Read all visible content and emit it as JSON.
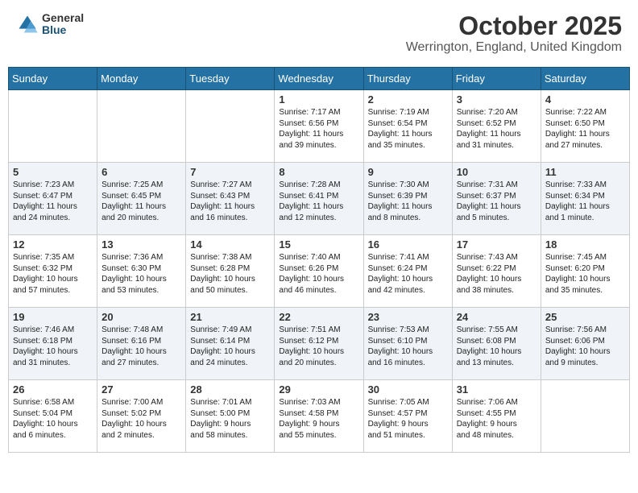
{
  "header": {
    "logo_general": "General",
    "logo_blue": "Blue",
    "month_title": "October 2025",
    "location": "Werrington, England, United Kingdom"
  },
  "days_of_week": [
    "Sunday",
    "Monday",
    "Tuesday",
    "Wednesday",
    "Thursday",
    "Friday",
    "Saturday"
  ],
  "weeks": [
    {
      "shaded": false,
      "days": [
        {
          "num": "",
          "info": ""
        },
        {
          "num": "",
          "info": ""
        },
        {
          "num": "",
          "info": ""
        },
        {
          "num": "1",
          "info": "Sunrise: 7:17 AM\nSunset: 6:56 PM\nDaylight: 11 hours\nand 39 minutes."
        },
        {
          "num": "2",
          "info": "Sunrise: 7:19 AM\nSunset: 6:54 PM\nDaylight: 11 hours\nand 35 minutes."
        },
        {
          "num": "3",
          "info": "Sunrise: 7:20 AM\nSunset: 6:52 PM\nDaylight: 11 hours\nand 31 minutes."
        },
        {
          "num": "4",
          "info": "Sunrise: 7:22 AM\nSunset: 6:50 PM\nDaylight: 11 hours\nand 27 minutes."
        }
      ]
    },
    {
      "shaded": true,
      "days": [
        {
          "num": "5",
          "info": "Sunrise: 7:23 AM\nSunset: 6:47 PM\nDaylight: 11 hours\nand 24 minutes."
        },
        {
          "num": "6",
          "info": "Sunrise: 7:25 AM\nSunset: 6:45 PM\nDaylight: 11 hours\nand 20 minutes."
        },
        {
          "num": "7",
          "info": "Sunrise: 7:27 AM\nSunset: 6:43 PM\nDaylight: 11 hours\nand 16 minutes."
        },
        {
          "num": "8",
          "info": "Sunrise: 7:28 AM\nSunset: 6:41 PM\nDaylight: 11 hours\nand 12 minutes."
        },
        {
          "num": "9",
          "info": "Sunrise: 7:30 AM\nSunset: 6:39 PM\nDaylight: 11 hours\nand 8 minutes."
        },
        {
          "num": "10",
          "info": "Sunrise: 7:31 AM\nSunset: 6:37 PM\nDaylight: 11 hours\nand 5 minutes."
        },
        {
          "num": "11",
          "info": "Sunrise: 7:33 AM\nSunset: 6:34 PM\nDaylight: 11 hours\nand 1 minute."
        }
      ]
    },
    {
      "shaded": false,
      "days": [
        {
          "num": "12",
          "info": "Sunrise: 7:35 AM\nSunset: 6:32 PM\nDaylight: 10 hours\nand 57 minutes."
        },
        {
          "num": "13",
          "info": "Sunrise: 7:36 AM\nSunset: 6:30 PM\nDaylight: 10 hours\nand 53 minutes."
        },
        {
          "num": "14",
          "info": "Sunrise: 7:38 AM\nSunset: 6:28 PM\nDaylight: 10 hours\nand 50 minutes."
        },
        {
          "num": "15",
          "info": "Sunrise: 7:40 AM\nSunset: 6:26 PM\nDaylight: 10 hours\nand 46 minutes."
        },
        {
          "num": "16",
          "info": "Sunrise: 7:41 AM\nSunset: 6:24 PM\nDaylight: 10 hours\nand 42 minutes."
        },
        {
          "num": "17",
          "info": "Sunrise: 7:43 AM\nSunset: 6:22 PM\nDaylight: 10 hours\nand 38 minutes."
        },
        {
          "num": "18",
          "info": "Sunrise: 7:45 AM\nSunset: 6:20 PM\nDaylight: 10 hours\nand 35 minutes."
        }
      ]
    },
    {
      "shaded": true,
      "days": [
        {
          "num": "19",
          "info": "Sunrise: 7:46 AM\nSunset: 6:18 PM\nDaylight: 10 hours\nand 31 minutes."
        },
        {
          "num": "20",
          "info": "Sunrise: 7:48 AM\nSunset: 6:16 PM\nDaylight: 10 hours\nand 27 minutes."
        },
        {
          "num": "21",
          "info": "Sunrise: 7:49 AM\nSunset: 6:14 PM\nDaylight: 10 hours\nand 24 minutes."
        },
        {
          "num": "22",
          "info": "Sunrise: 7:51 AM\nSunset: 6:12 PM\nDaylight: 10 hours\nand 20 minutes."
        },
        {
          "num": "23",
          "info": "Sunrise: 7:53 AM\nSunset: 6:10 PM\nDaylight: 10 hours\nand 16 minutes."
        },
        {
          "num": "24",
          "info": "Sunrise: 7:55 AM\nSunset: 6:08 PM\nDaylight: 10 hours\nand 13 minutes."
        },
        {
          "num": "25",
          "info": "Sunrise: 7:56 AM\nSunset: 6:06 PM\nDaylight: 10 hours\nand 9 minutes."
        }
      ]
    },
    {
      "shaded": false,
      "days": [
        {
          "num": "26",
          "info": "Sunrise: 6:58 AM\nSunset: 5:04 PM\nDaylight: 10 hours\nand 6 minutes."
        },
        {
          "num": "27",
          "info": "Sunrise: 7:00 AM\nSunset: 5:02 PM\nDaylight: 10 hours\nand 2 minutes."
        },
        {
          "num": "28",
          "info": "Sunrise: 7:01 AM\nSunset: 5:00 PM\nDaylight: 9 hours\nand 58 minutes."
        },
        {
          "num": "29",
          "info": "Sunrise: 7:03 AM\nSunset: 4:58 PM\nDaylight: 9 hours\nand 55 minutes."
        },
        {
          "num": "30",
          "info": "Sunrise: 7:05 AM\nSunset: 4:57 PM\nDaylight: 9 hours\nand 51 minutes."
        },
        {
          "num": "31",
          "info": "Sunrise: 7:06 AM\nSunset: 4:55 PM\nDaylight: 9 hours\nand 48 minutes."
        },
        {
          "num": "",
          "info": ""
        }
      ]
    }
  ]
}
